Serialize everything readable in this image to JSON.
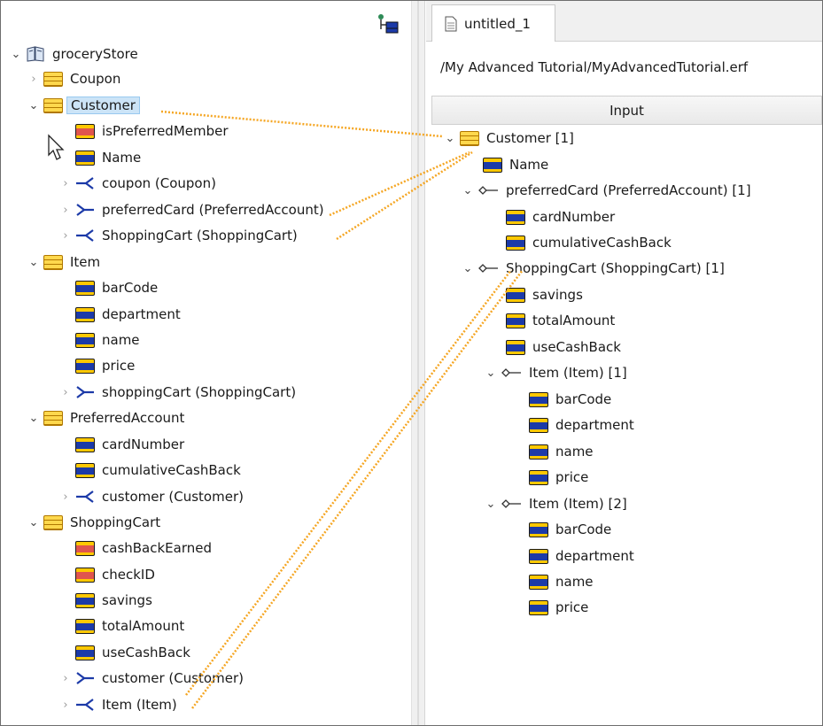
{
  "left_tree": {
    "root": "groceryStore",
    "rows": [
      {
        "label": "Coupon"
      },
      {
        "label": "Customer"
      },
      {
        "label": "isPreferredMember"
      },
      {
        "label": "Name"
      },
      {
        "label": "coupon (Coupon)"
      },
      {
        "label": "preferredCard (PreferredAccount)"
      },
      {
        "label": "ShoppingCart (ShoppingCart)"
      },
      {
        "label": "Item"
      },
      {
        "label": "barCode"
      },
      {
        "label": "department"
      },
      {
        "label": "name"
      },
      {
        "label": "price"
      },
      {
        "label": "shoppingCart (ShoppingCart)"
      },
      {
        "label": "PreferredAccount"
      },
      {
        "label": "cardNumber"
      },
      {
        "label": "cumulativeCashBack"
      },
      {
        "label": "customer (Customer)"
      },
      {
        "label": "ShoppingCart"
      },
      {
        "label": "cashBackEarned"
      },
      {
        "label": "checkID"
      },
      {
        "label": "savings"
      },
      {
        "label": "totalAmount"
      },
      {
        "label": "useCashBack"
      },
      {
        "label": "customer (Customer)"
      },
      {
        "label": "Item (Item)"
      }
    ]
  },
  "editor": {
    "tab_title": "untitled_1",
    "path": "/My Advanced Tutorial/MyAdvancedTutorial.erf",
    "input_header": "Input"
  },
  "right_tree": {
    "rows": [
      {
        "label": "Customer [1]"
      },
      {
        "label": "Name"
      },
      {
        "label": "preferredCard (PreferredAccount) [1]"
      },
      {
        "label": "cardNumber"
      },
      {
        "label": "cumulativeCashBack"
      },
      {
        "label": "ShoppingCart (ShoppingCart) [1]"
      },
      {
        "label": "savings"
      },
      {
        "label": "totalAmount"
      },
      {
        "label": "useCashBack"
      },
      {
        "label": "Item (Item) [1]"
      },
      {
        "label": "barCode"
      },
      {
        "label": "department"
      },
      {
        "label": "name"
      },
      {
        "label": "price"
      },
      {
        "label": "Item (Item) [2]"
      },
      {
        "label": "barCode"
      },
      {
        "label": "department"
      },
      {
        "label": "name"
      },
      {
        "label": "price"
      }
    ]
  },
  "icons": {
    "toolbar": "link-with-editor-icon",
    "document": "document-icon",
    "model": "book-icon",
    "class": "class-icon",
    "attribute": "attribute-icon",
    "key_attribute": "key-attribute-icon",
    "relationship_outgoing": "relationship-outgoing-icon",
    "relationship_incoming": "relationship-incoming-icon",
    "role": "role-icon",
    "cursor": "cursor-icon"
  },
  "colors": {
    "mapping_line": "#f5a623",
    "selection": "#cce4f7",
    "attribute_bar": "#1c3aa8",
    "key_attribute_bar": "#e0554e",
    "class_fill": "#ffd84d"
  }
}
